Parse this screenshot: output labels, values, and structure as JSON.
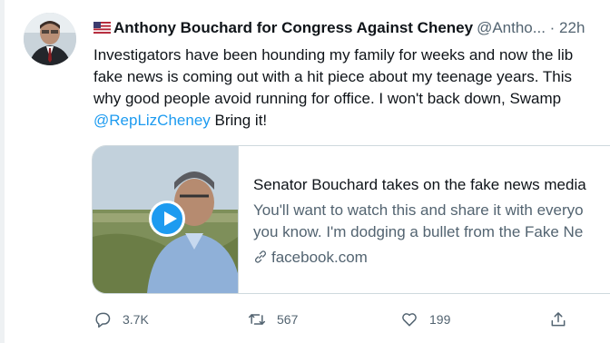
{
  "tweet": {
    "display_name": "Anthony Bouchard for Congress Against Cheney",
    "handle": "@Antho...",
    "time": "· 22h",
    "text_lines": [
      "Investigators have been hounding my family for weeks and now the lib",
      "fake news is coming out with a hit piece about my teenage years.  This",
      "why good people avoid running for office. I won't back down, Swamp"
    ],
    "mention": "@RepLizCheney",
    "text_tail": " Bring it!"
  },
  "card": {
    "title": "Senator Bouchard takes on the fake news media",
    "description_lines": [
      "You'll want to watch this and share it with everyo",
      "you know. I'm dodging a bullet from the Fake Ne"
    ],
    "domain": "facebook.com"
  },
  "actions": {
    "replies": "3.7K",
    "retweets": "567",
    "likes": "199"
  },
  "colors": {
    "link": "#1d9bf0",
    "secondary_text": "#536471",
    "border": "#cfd9de"
  },
  "icons": [
    "reply-icon",
    "retweet-icon",
    "like-icon",
    "share-icon",
    "link-icon",
    "play-icon",
    "us-flag-icon"
  ]
}
